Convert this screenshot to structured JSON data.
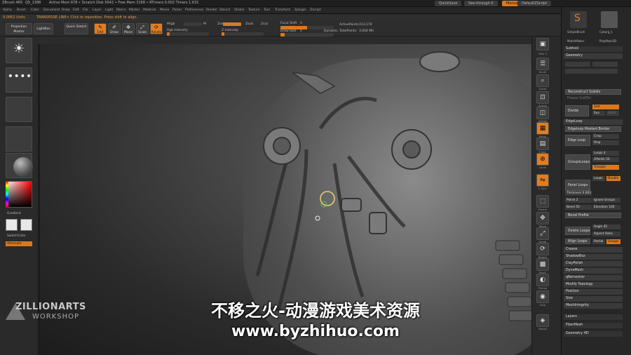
{
  "titlebar": {
    "app": "ZBrush 4R5",
    "qs": "QS_1388",
    "status": "Active Mem 878 • Scratch Disk 5642 • Free Mem 3168 • RTimers 0.002 Timers 1.631",
    "quicksave": "QuickSave",
    "seethrough": "See-through 0",
    "menus_label": "Menus",
    "script": "DefaultZScript"
  },
  "menubar": {
    "items": [
      "Alpha",
      "Brush",
      "Color",
      "Document",
      "Draw",
      "Edit",
      "File",
      "Layer",
      "Light",
      "Macro",
      "Marker",
      "Material",
      "Movie",
      "Picker",
      "Preferences",
      "Render",
      "Stencil",
      "Stroke",
      "Texture",
      "Tool",
      "Transform",
      "Zplugin",
      "Zscript"
    ]
  },
  "infobar": {
    "units_value": "0.0952 Units",
    "message": "TRANSPOSE LINE> Click to reposition. Press shift to align."
  },
  "toolbar": {
    "projection_master": "Projection Master",
    "lightbox": "LightBox",
    "quick_sketch": "Quick Sketch",
    "edit": "Edit",
    "draw": "Draw",
    "move": "Move",
    "scale": "Scale",
    "rotate": "Rotate",
    "mrgb": "Mrgb",
    "rgb": "Rgb",
    "m": "M",
    "zadd": "Zadd",
    "zsub": "Zsub",
    "zcut": "Zcut",
    "rgb_intensity": "Rgb Intensity",
    "z_intensity": "Z Intensity",
    "focal_shift_label": "Focal Shift",
    "focal_shift_value": "0",
    "draw_size_label": "Draw Size",
    "draw_size_value": "4",
    "dynamic": "Dynamic",
    "active_points_label": "ActivePoints:",
    "active_points_value": "313,170",
    "total_points_label": "TotalPoints:",
    "total_points_value": "3.004 Mil"
  },
  "leftshelf": {
    "gradient": "Gradient",
    "switch_color": "SwitchColor",
    "alternate": "Alternate"
  },
  "rightshelf": {
    "buttons": [
      "BPR",
      "SPix 3",
      "Scroll",
      "Zoom",
      "Actual",
      "AAHalf",
      "Persp",
      "Floor",
      "Local",
      "L.Sym",
      "Gxyz",
      "Frame",
      "Move",
      "Scale",
      "Rotate",
      "PolyF",
      "Transp",
      "Ghost",
      "Solo",
      "Xpose"
    ]
  },
  "panel": {
    "tool_a": "SimpleBrush",
    "tool_b": "Cyborg_1",
    "tool_c": "MatchMaker",
    "tool_d": "PolyMesh3D",
    "subtool": "Subtool",
    "geometry": "Geometry",
    "reconstruct": "Reconstruct Subdiv",
    "freeze": "Freeze SubDiv",
    "divide": "Divide",
    "smt": "Smt",
    "suv": "Suv",
    "rsuv": "ReUV",
    "edgeloop": "EdgeLoop",
    "edgeloop_masked": "Edgeloop Masked Border",
    "edge_loop": "Edge Loop",
    "crisp": "Crisp",
    "disp": "Disp",
    "grouploops": "GroupsLoops",
    "loops": "Loops 4",
    "gpolish": "GPolish 50",
    "triangle": "Triangle",
    "panel_loops": "Panel Loops",
    "loops2": "Loops",
    "double": "Double",
    "thickness": "Thickness 0.003",
    "polish": "Polish 2",
    "ignore_groups": "Ignore Groups",
    "bevel": "Bevel 50",
    "elevation": "Elevation 100",
    "bevel_profile": "Bevel Profile",
    "delete_loops": "Delete Loops",
    "angle": "Angle 45",
    "aspect_ratio": "Aspect Ratio",
    "align_loops": "Align Loops",
    "partial": "Partial",
    "groups": "Groups",
    "items": [
      "Crease",
      "ShadowBox",
      "ClayPolish",
      "DynaMesh",
      "qRemesher",
      "Modify Topology",
      "Position",
      "Size",
      "MeshIntegrity"
    ],
    "layers": "Layers",
    "fibermesh": "FiberMesh",
    "geometry_hd": "Geometry HD"
  },
  "watermark": {
    "logo": "ZILLIONARTS",
    "logo_sub": "WORKSHOP",
    "cn_text": "不移之火-动漫游戏美术资源",
    "url": "www.byzhihuo.com"
  },
  "colors": {
    "accent": "#e07d22",
    "panel_bg": "#272727",
    "canvas_bg": "#3a3a3a"
  }
}
